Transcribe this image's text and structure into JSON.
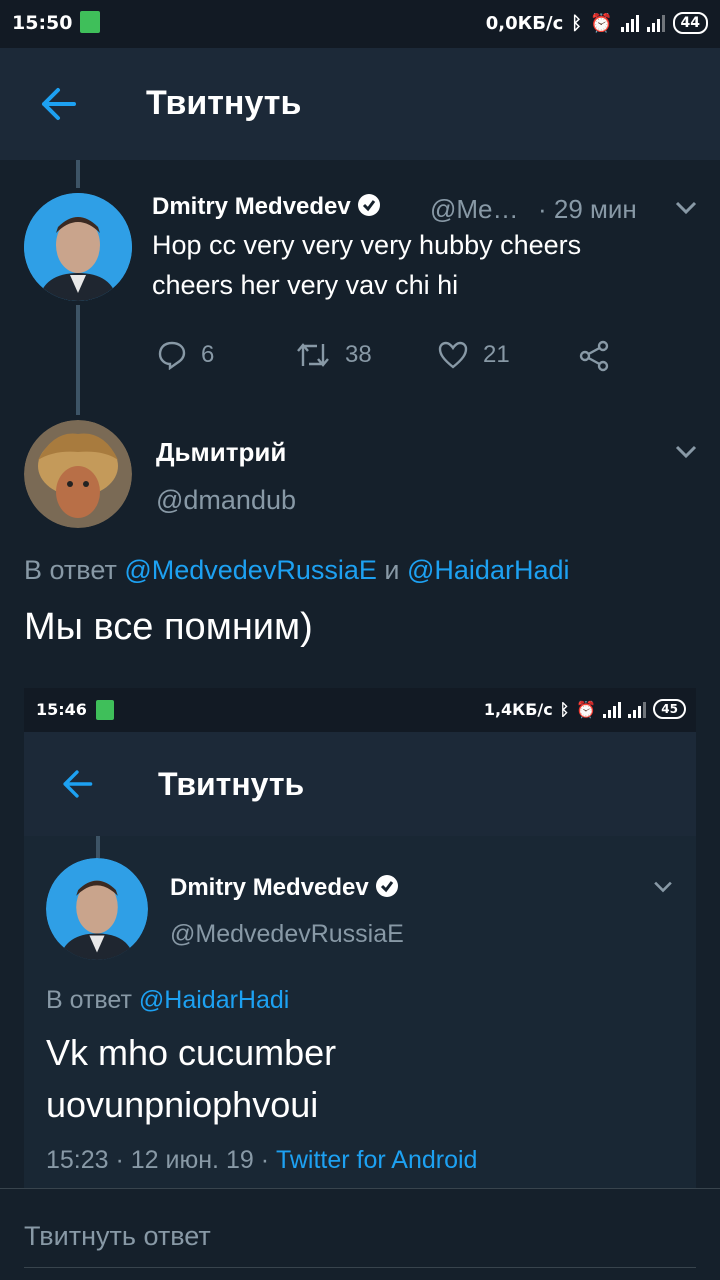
{
  "status_bar": {
    "time": "15:50",
    "speed": "0,0КБ/с",
    "battery": "44"
  },
  "header": {
    "title": "Твитнуть"
  },
  "parent_tweet": {
    "name": "Dmitry Medvedev",
    "handle": "@Me…",
    "time": "· 29 мин",
    "text_line1": "Hop cc very very very hubby cheers",
    "text_line2": "cheers her very vav chi hi",
    "replies": "6",
    "retweets": "38",
    "likes": "21"
  },
  "reply_tweet": {
    "name": "Дьмитрий",
    "handle": "@dmandub",
    "reply_prefix": "В ответ",
    "mention1": "@MedvedevRussiaE",
    "and_word": "и",
    "mention2": "@HaidarHadi",
    "text": "Мы все помним)"
  },
  "embedded": {
    "status_time": "15:46",
    "status_speed": "1,4КБ/с",
    "status_battery": "45",
    "title": "Твитнуть",
    "name": "Dmitry Medvedev",
    "handle": "@MedvedevRussiaE",
    "reply_prefix": "В ответ",
    "mention": "@HaidarHadi",
    "text_line1": "Vk mho cucumber",
    "text_line2": "uovunpniophvoui",
    "meta": "15:23 · 12 июн. 19 ·",
    "source": "Twitter for Android"
  },
  "compose": {
    "placeholder": "Твитнуть ответ"
  },
  "colors": {
    "accent": "#1da1f2",
    "background": "#15202b",
    "muted": "#8899a6"
  }
}
